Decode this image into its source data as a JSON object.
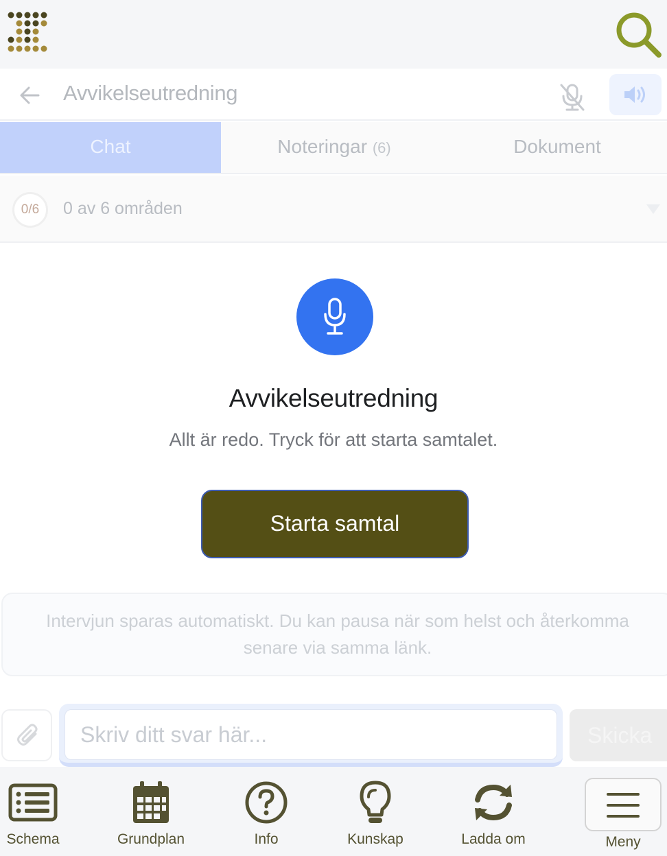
{
  "header": {
    "title": "Avvikelseutredning"
  },
  "tabs": [
    {
      "label": "Chat",
      "count": ""
    },
    {
      "label": "Noteringar",
      "count": "(6)"
    },
    {
      "label": "Dokument",
      "count": ""
    }
  ],
  "progress": {
    "badge": "0/6",
    "text": "0 av 6 områden"
  },
  "main": {
    "title": "Avvikelseutredning",
    "subtitle": "Allt är redo. Tryck för att starta samtalet.",
    "start_button": "Starta samtal"
  },
  "notice": {
    "text": "Intervjun sparas automatiskt. Du kan pausa när som helst och återkomma senare via samma länk."
  },
  "composer": {
    "placeholder": "Skriv ditt svar här...",
    "send_label": "Skicka"
  },
  "bottom_nav": [
    {
      "label": "Schema",
      "icon": "list-icon"
    },
    {
      "label": "Grundplan",
      "icon": "calendar-icon"
    },
    {
      "label": "Info",
      "icon": "question-circle-icon"
    },
    {
      "label": "Kunskap",
      "icon": "lightbulb-icon"
    },
    {
      "label": "Ladda om",
      "icon": "refresh-icon"
    },
    {
      "label": "Meny",
      "icon": "hamburger-icon"
    }
  ],
  "colors": {
    "brand_olive": "#544f15",
    "accent_blue": "#3373f0",
    "active_tab": "#c1d1fb",
    "search_icon": "#8b9a2a"
  }
}
